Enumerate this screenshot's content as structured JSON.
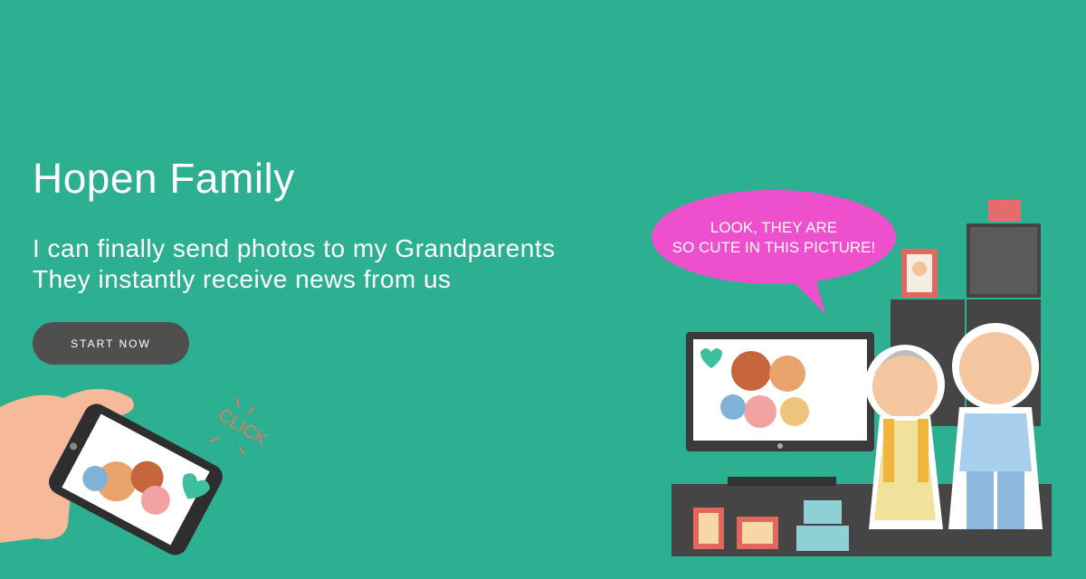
{
  "hero": {
    "title": "Hopen Family",
    "subtitle_line1": "I can finally send photos to my Grandparents",
    "subtitle_line2": "They instantly receive news from us",
    "cta_label": "START NOW"
  },
  "illustration": {
    "speech_bubble_line1": "LOOK, THEY ARE",
    "speech_bubble_line2": "SO CUTE IN THIS PICTURE!",
    "click_label": "CLICK"
  },
  "colors": {
    "background": "#2daf91",
    "button": "#4f4f4f",
    "bubble": "#ee4fcc",
    "text": "#ffffff"
  },
  "icons": [
    "phone-icon",
    "hand-icon",
    "heart-icon",
    "tv-icon",
    "speech-bubble-icon",
    "picture-frame-icon",
    "grandma-icon",
    "grandpa-icon"
  ]
}
